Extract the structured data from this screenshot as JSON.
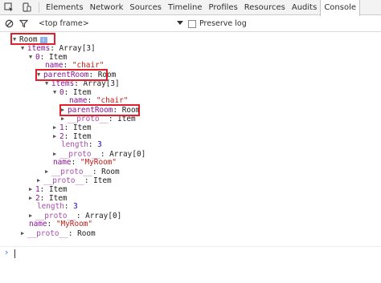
{
  "toolbar": {
    "tabs": [
      "Elements",
      "Network",
      "Sources",
      "Timeline",
      "Profiles",
      "Resources",
      "Audits",
      "Console"
    ],
    "active_tab": "Console"
  },
  "filterbar": {
    "frame_label": "<top frame>",
    "preserve_log_label": "Preserve log"
  },
  "console": {
    "lines": [
      {
        "arrow": "▼",
        "key": "Room",
        "val": "",
        "badge": "i"
      },
      {
        "arrow": "▼",
        "key": "items",
        "sep": ": ",
        "val": "Array[3]"
      },
      {
        "arrow": "▼",
        "key": "0",
        "sep": ": ",
        "val": "Item"
      },
      {
        "arrow": "",
        "key": "name",
        "sep": ": ",
        "val": "\"chair\""
      },
      {
        "arrow": "▼",
        "key": "parentRoom",
        "sep": ": ",
        "val": "Room"
      },
      {
        "arrow": "▼",
        "key": "items",
        "sep": ": ",
        "val": "Array[3]"
      },
      {
        "arrow": "▼",
        "key": "0",
        "sep": ": ",
        "val": "Item"
      },
      {
        "arrow": "",
        "key": "name",
        "sep": ": ",
        "val": "\"chair\""
      },
      {
        "arrow": "▶",
        "key": "parentRoom",
        "sep": ": ",
        "val": "Room"
      },
      {
        "arrow": "▶",
        "key": "__proto__",
        "sep": ": ",
        "val": "Item"
      },
      {
        "arrow": "▶",
        "key": "1",
        "sep": ": ",
        "val": "Item"
      },
      {
        "arrow": "▶",
        "key": "2",
        "sep": ": ",
        "val": "Item"
      },
      {
        "arrow": "",
        "key": "length",
        "sep": ": ",
        "val": "3"
      },
      {
        "arrow": "▶",
        "key": "__proto__",
        "sep": ": ",
        "val": "Array[0]"
      },
      {
        "arrow": "",
        "key": "name",
        "sep": ": ",
        "val": "\"MyRoom\""
      },
      {
        "arrow": "▶",
        "key": "__proto__",
        "sep": ": ",
        "val": "Room"
      },
      {
        "arrow": "▶",
        "key": "__proto__",
        "sep": ": ",
        "val": "Item"
      },
      {
        "arrow": "▶",
        "key": "1",
        "sep": ": ",
        "val": "Item"
      },
      {
        "arrow": "▶",
        "key": "2",
        "sep": ": ",
        "val": "Item"
      },
      {
        "arrow": "",
        "key": "length",
        "sep": ": ",
        "val": "3"
      },
      {
        "arrow": "▶",
        "key": "__proto__",
        "sep": ": ",
        "val": "Array[0]"
      },
      {
        "arrow": "",
        "key": "name",
        "sep": ": ",
        "val": "\"MyRoom\""
      },
      {
        "arrow": "▶",
        "key": "__proto__",
        "sep": ": ",
        "val": "Room"
      }
    ]
  },
  "colors": {
    "highlight": "#e0202a",
    "property_key": "#881391",
    "string_value": "#c41a16",
    "number_value": "#1c00cf",
    "prompt": "#2d7cf0"
  },
  "icons": {
    "inspect": "inspect-icon",
    "device": "device-mode-icon",
    "clear": "clear-console-icon",
    "filter": "filter-icon",
    "dropdown": "chevron-down-icon",
    "prompt": "prompt-chevron-icon"
  }
}
